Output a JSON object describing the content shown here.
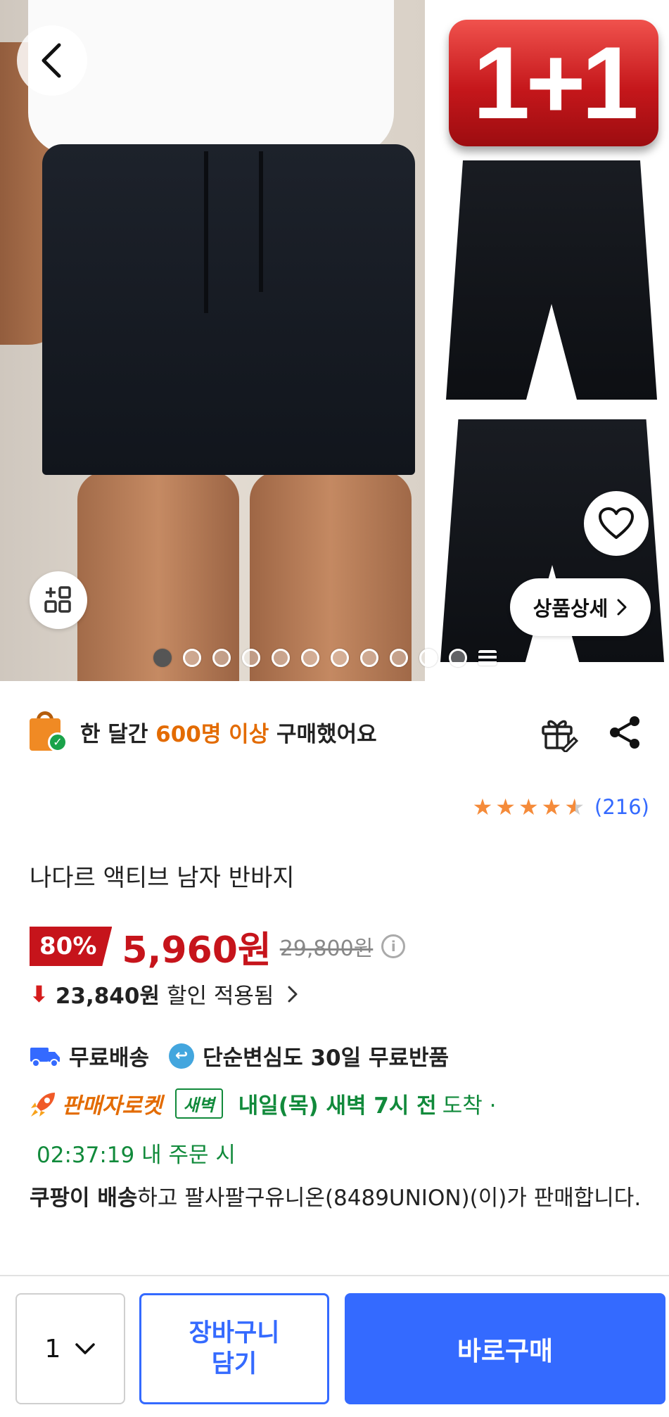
{
  "gallery": {
    "badge_text": "1+1",
    "detail_button_label": "상품상세",
    "total_slides": 12,
    "active_slide": 1
  },
  "buyers": {
    "prefix": "한 달간 ",
    "highlight": "600명 이상",
    "suffix": " 구매했어요",
    "highlight_color": "#e36b00"
  },
  "rating": {
    "stars": 4.5,
    "count": "(216)"
  },
  "product": {
    "title": "나다르 액티브 남자 반바지"
  },
  "price": {
    "discount_percent": "80%",
    "sale_price": "5,960원",
    "original_price": "29,800원",
    "discount_amount": "23,840원",
    "discount_text": "할인 적용됨",
    "sale_color": "#c6141b"
  },
  "shipping": {
    "free_shipping": "무료배송",
    "free_return": "단순변심도 30일 무료반품"
  },
  "delivery": {
    "rocket_label": "판매자로켓",
    "dawn_badge": "새벽",
    "arrival": "내일(목) 새벽 7시 전",
    "arrival_suffix": "도착 ·",
    "countdown": "02:37:19 내 주문 시",
    "delivery_color": "#118a3b"
  },
  "seller": {
    "bold": "쿠팡이 배송",
    "rest": "하고 팔사팔구유니온(8489UNION)(이)가 판매합니다."
  },
  "bottom_bar": {
    "quantity": "1",
    "cart_label_line1": "장바구니",
    "cart_label_line2": "담기",
    "buy_label": "바로구매",
    "accent_color": "#346aff"
  },
  "icons": {
    "back": "chevron-left-icon",
    "grid": "grid-plus-icon",
    "heart": "heart-icon",
    "bag": "shopping-bag-check-icon",
    "gift": "gift-rocket-icon",
    "share": "share-icon",
    "truck": "truck-icon",
    "return": "return-icon",
    "rocket": "rocket-icon",
    "down_arrow": "arrow-down-icon",
    "info": "info-icon",
    "chevron_down": "chevron-down-icon"
  }
}
